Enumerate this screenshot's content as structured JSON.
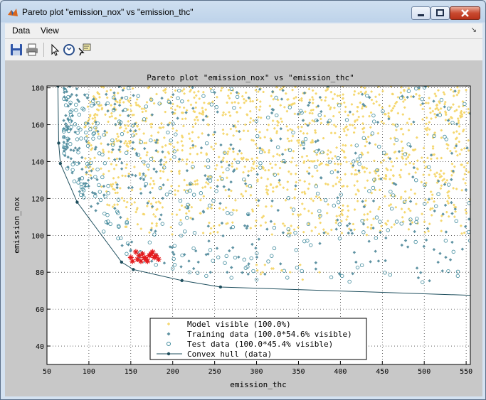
{
  "window": {
    "title": "Pareto plot \"emission_nox\" vs \"emission_thc\""
  },
  "menu": {
    "items": [
      "Data",
      "View"
    ]
  },
  "toolbar": {
    "buttons": [
      "save-icon",
      "print-icon",
      "pointer-icon",
      "rotate-icon",
      "data-cursor-icon"
    ]
  },
  "chart_data": {
    "type": "scatter",
    "title": "Pareto plot \"emission_nox\" vs \"emission_thc\"",
    "xlabel": "emission_thc",
    "ylabel": "emission_nox",
    "xlim": [
      50,
      555
    ],
    "ylim": [
      30,
      181
    ],
    "xticks": [
      50,
      100,
      150,
      200,
      250,
      300,
      350,
      400,
      450,
      500,
      550
    ],
    "yticks": [
      40,
      60,
      80,
      100,
      120,
      140,
      160,
      180
    ],
    "grid": true,
    "legend_position": "bottom-center",
    "colors": {
      "model": "#f5d76e",
      "training": "#5f93a3",
      "test": "#3f8a9c",
      "hull": "#1f4f5e",
      "highlight": "#e41a1c"
    },
    "series": [
      {
        "name": "Model visible (100.0%)",
        "marker": "dot",
        "x": [
          300,
          307,
          310,
          320,
          340,
          355,
          375,
          305,
          330,
          352,
          301,
          318
        ],
        "y": [
          84,
          80,
          84,
          82,
          80,
          76,
          80,
          79,
          81,
          84,
          81,
          82
        ]
      },
      {
        "name": "Training data (100.0*54.6% visible)",
        "marker": "diamond",
        "x": [
          150,
          160,
          175,
          190,
          210,
          225,
          245,
          265,
          290,
          310
        ],
        "y": [
          92,
          88,
          86,
          85,
          83,
          82,
          80,
          80,
          79,
          79
        ]
      },
      {
        "name": "Test data (100.0*45.4% visible)",
        "marker": "circle",
        "x": [
          145,
          165,
          180,
          200,
          220,
          240,
          270,
          300,
          402,
          540
        ],
        "y": [
          90,
          86,
          84,
          82,
          80,
          78,
          77,
          76,
          78,
          78
        ]
      },
      {
        "name": "Convex hull (data)",
        "marker": "line-dot",
        "x": [
          63,
          64,
          66,
          86,
          139,
          153,
          211,
          257,
          555
        ],
        "y": [
          181,
          150,
          139,
          118,
          85.5,
          81.5,
          75.5,
          72,
          67.5
        ]
      }
    ],
    "highlighted_points": {
      "marker": "star",
      "x": [
        150,
        156,
        160,
        164,
        168,
        172,
        176,
        180,
        152,
        158,
        166,
        170,
        178,
        183,
        162,
        174
      ],
      "y": [
        88,
        91,
        89,
        90,
        87,
        89,
        91,
        89,
        86,
        87,
        88,
        86,
        88,
        87,
        86,
        90
      ]
    },
    "density_clouds": [
      {
        "series": "Model visible (100.0%)",
        "x_range": [
          95,
          555
        ],
        "y_range": [
          95,
          181
        ]
      },
      {
        "series": "Training data (100.0*54.6% visible)",
        "x_range": [
          70,
          555
        ],
        "y_range": [
          85,
          181
        ]
      },
      {
        "series": "Test data (100.0*45.4% visible)",
        "x_range": [
          70,
          555
        ],
        "y_range": [
          85,
          181
        ]
      }
    ]
  }
}
